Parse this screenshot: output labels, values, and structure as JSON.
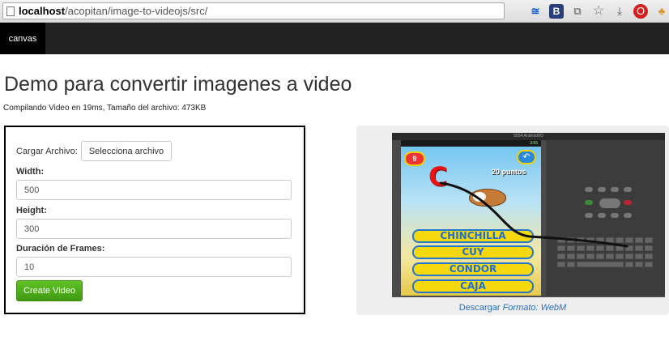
{
  "browser": {
    "url_host": "localhost",
    "url_path": "/acopitan/image-to-videojs/src/",
    "icons": [
      "rss-icon",
      "b-extension-icon",
      "translate-icon",
      "star-icon",
      "download-icon",
      "opera-icon",
      "hat-icon",
      "v-extension-icon"
    ]
  },
  "navbar": {
    "brand": "canvas"
  },
  "page": {
    "title": "Demo para convertir imagenes a video",
    "subtitle": "Compilando Video en 19ms, Tamaño del archivo: 473KB"
  },
  "form": {
    "file_label": "Cargar Archivo:",
    "file_button": "Selecciona archivo",
    "width_label": "Width:",
    "width_value": "500",
    "height_label": "Height:",
    "height_value": "300",
    "frames_label": "Duración de Frames:",
    "frames_value": "10",
    "submit_label": "Create Video"
  },
  "video": {
    "emulator_title": "5554:AndroidVD",
    "status_time": "3:55",
    "score": "9",
    "big_letter": "C",
    "points": "20 puntos",
    "answers": [
      "CHINCHILLA",
      "CUY",
      "CÓNDOR",
      "CAJA"
    ],
    "download_prefix": "Descargar ",
    "download_format": "Formato: WebM"
  },
  "colors": {
    "navbar_bg": "#222222",
    "create_button": "#4cae1c",
    "link": "#2a6fbf"
  }
}
